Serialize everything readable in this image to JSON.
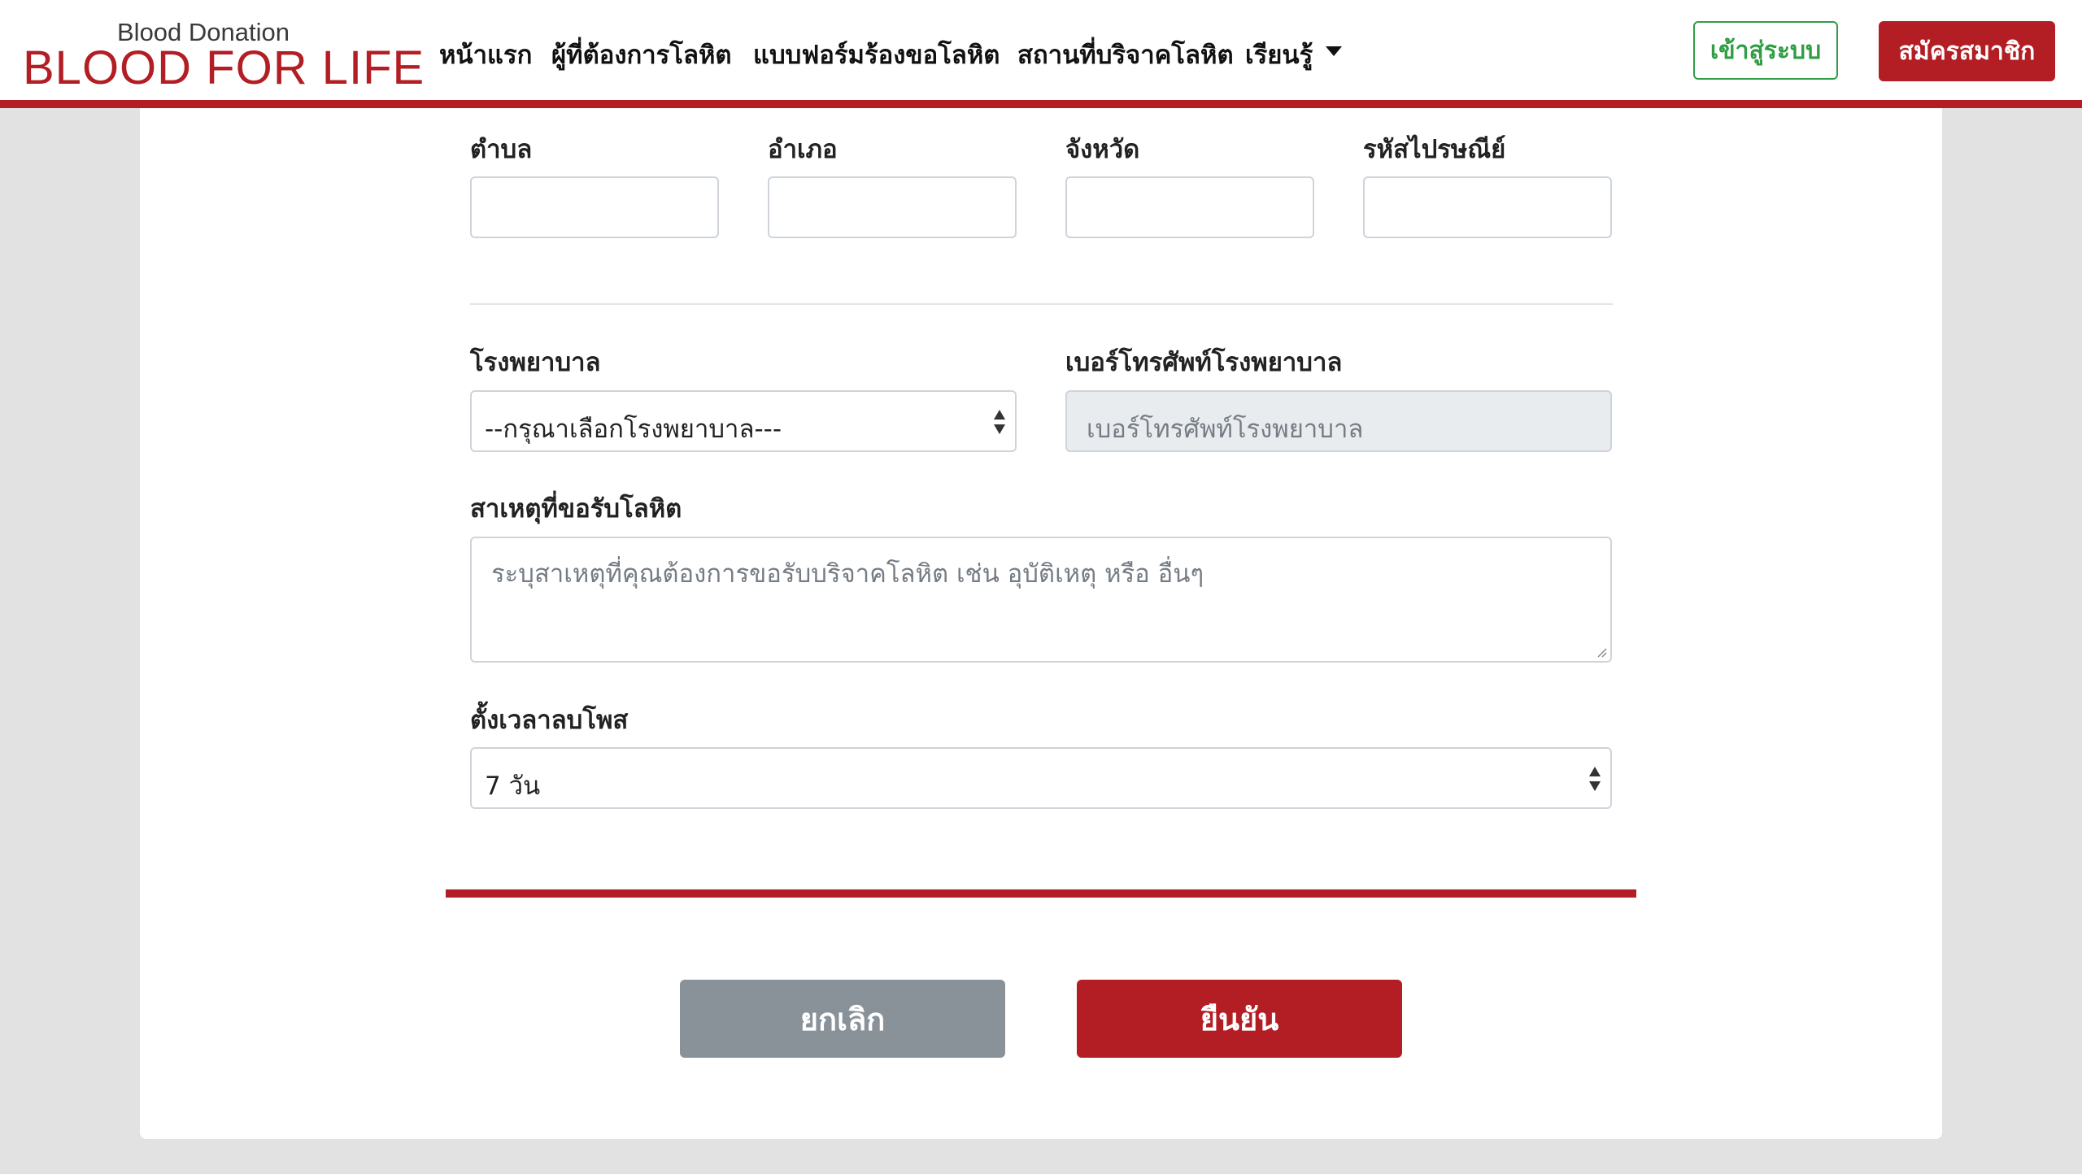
{
  "brand": {
    "subtitle": "Blood Donation",
    "title": "BLOOD FOR LIFE"
  },
  "nav": {
    "links": [
      "หน้าแรก",
      "ผู้ที่ต้องการโลหิต",
      "แบบฟอร์มร้องขอโลหิต",
      "สถานที่บริจาคโลหิต",
      "เรียนรู้"
    ],
    "login": "เข้าสู่ระบบ",
    "register": "สมัครสมาชิก"
  },
  "address": {
    "subdistrict_label": "ตำบล",
    "district_label": "อำเภอ",
    "province_label": "จังหวัด",
    "postcode_label": "รหัสไปรษณีย์",
    "subdistrict_value": "",
    "district_value": "",
    "province_value": "",
    "postcode_value": ""
  },
  "hospital": {
    "label": "โรงพยาบาล",
    "selected": "--กรุณาเลือกโรงพยาบาล---",
    "phone_label": "เบอร์โทรศัพท์โรงพยาบาล",
    "phone_placeholder": "เบอร์โทรศัพท์โรงพยาบาล"
  },
  "reason": {
    "label": "สาเหตุที่ขอรับโลหิต",
    "placeholder": "ระบุสาเหตุที่คุณต้องการขอรับบริจาคโลหิต เช่น อุบัติเหตุ หรือ อื่นๆ"
  },
  "expiry": {
    "label": "ตั้งเวลาลบโพส",
    "selected": "7 วัน"
  },
  "actions": {
    "cancel": "ยกเลิก",
    "confirm": "ยืนยัน"
  },
  "colors": {
    "brand_red": "#b31e24",
    "login_green": "#2f9e44",
    "cancel_gray": "#8a9299"
  }
}
